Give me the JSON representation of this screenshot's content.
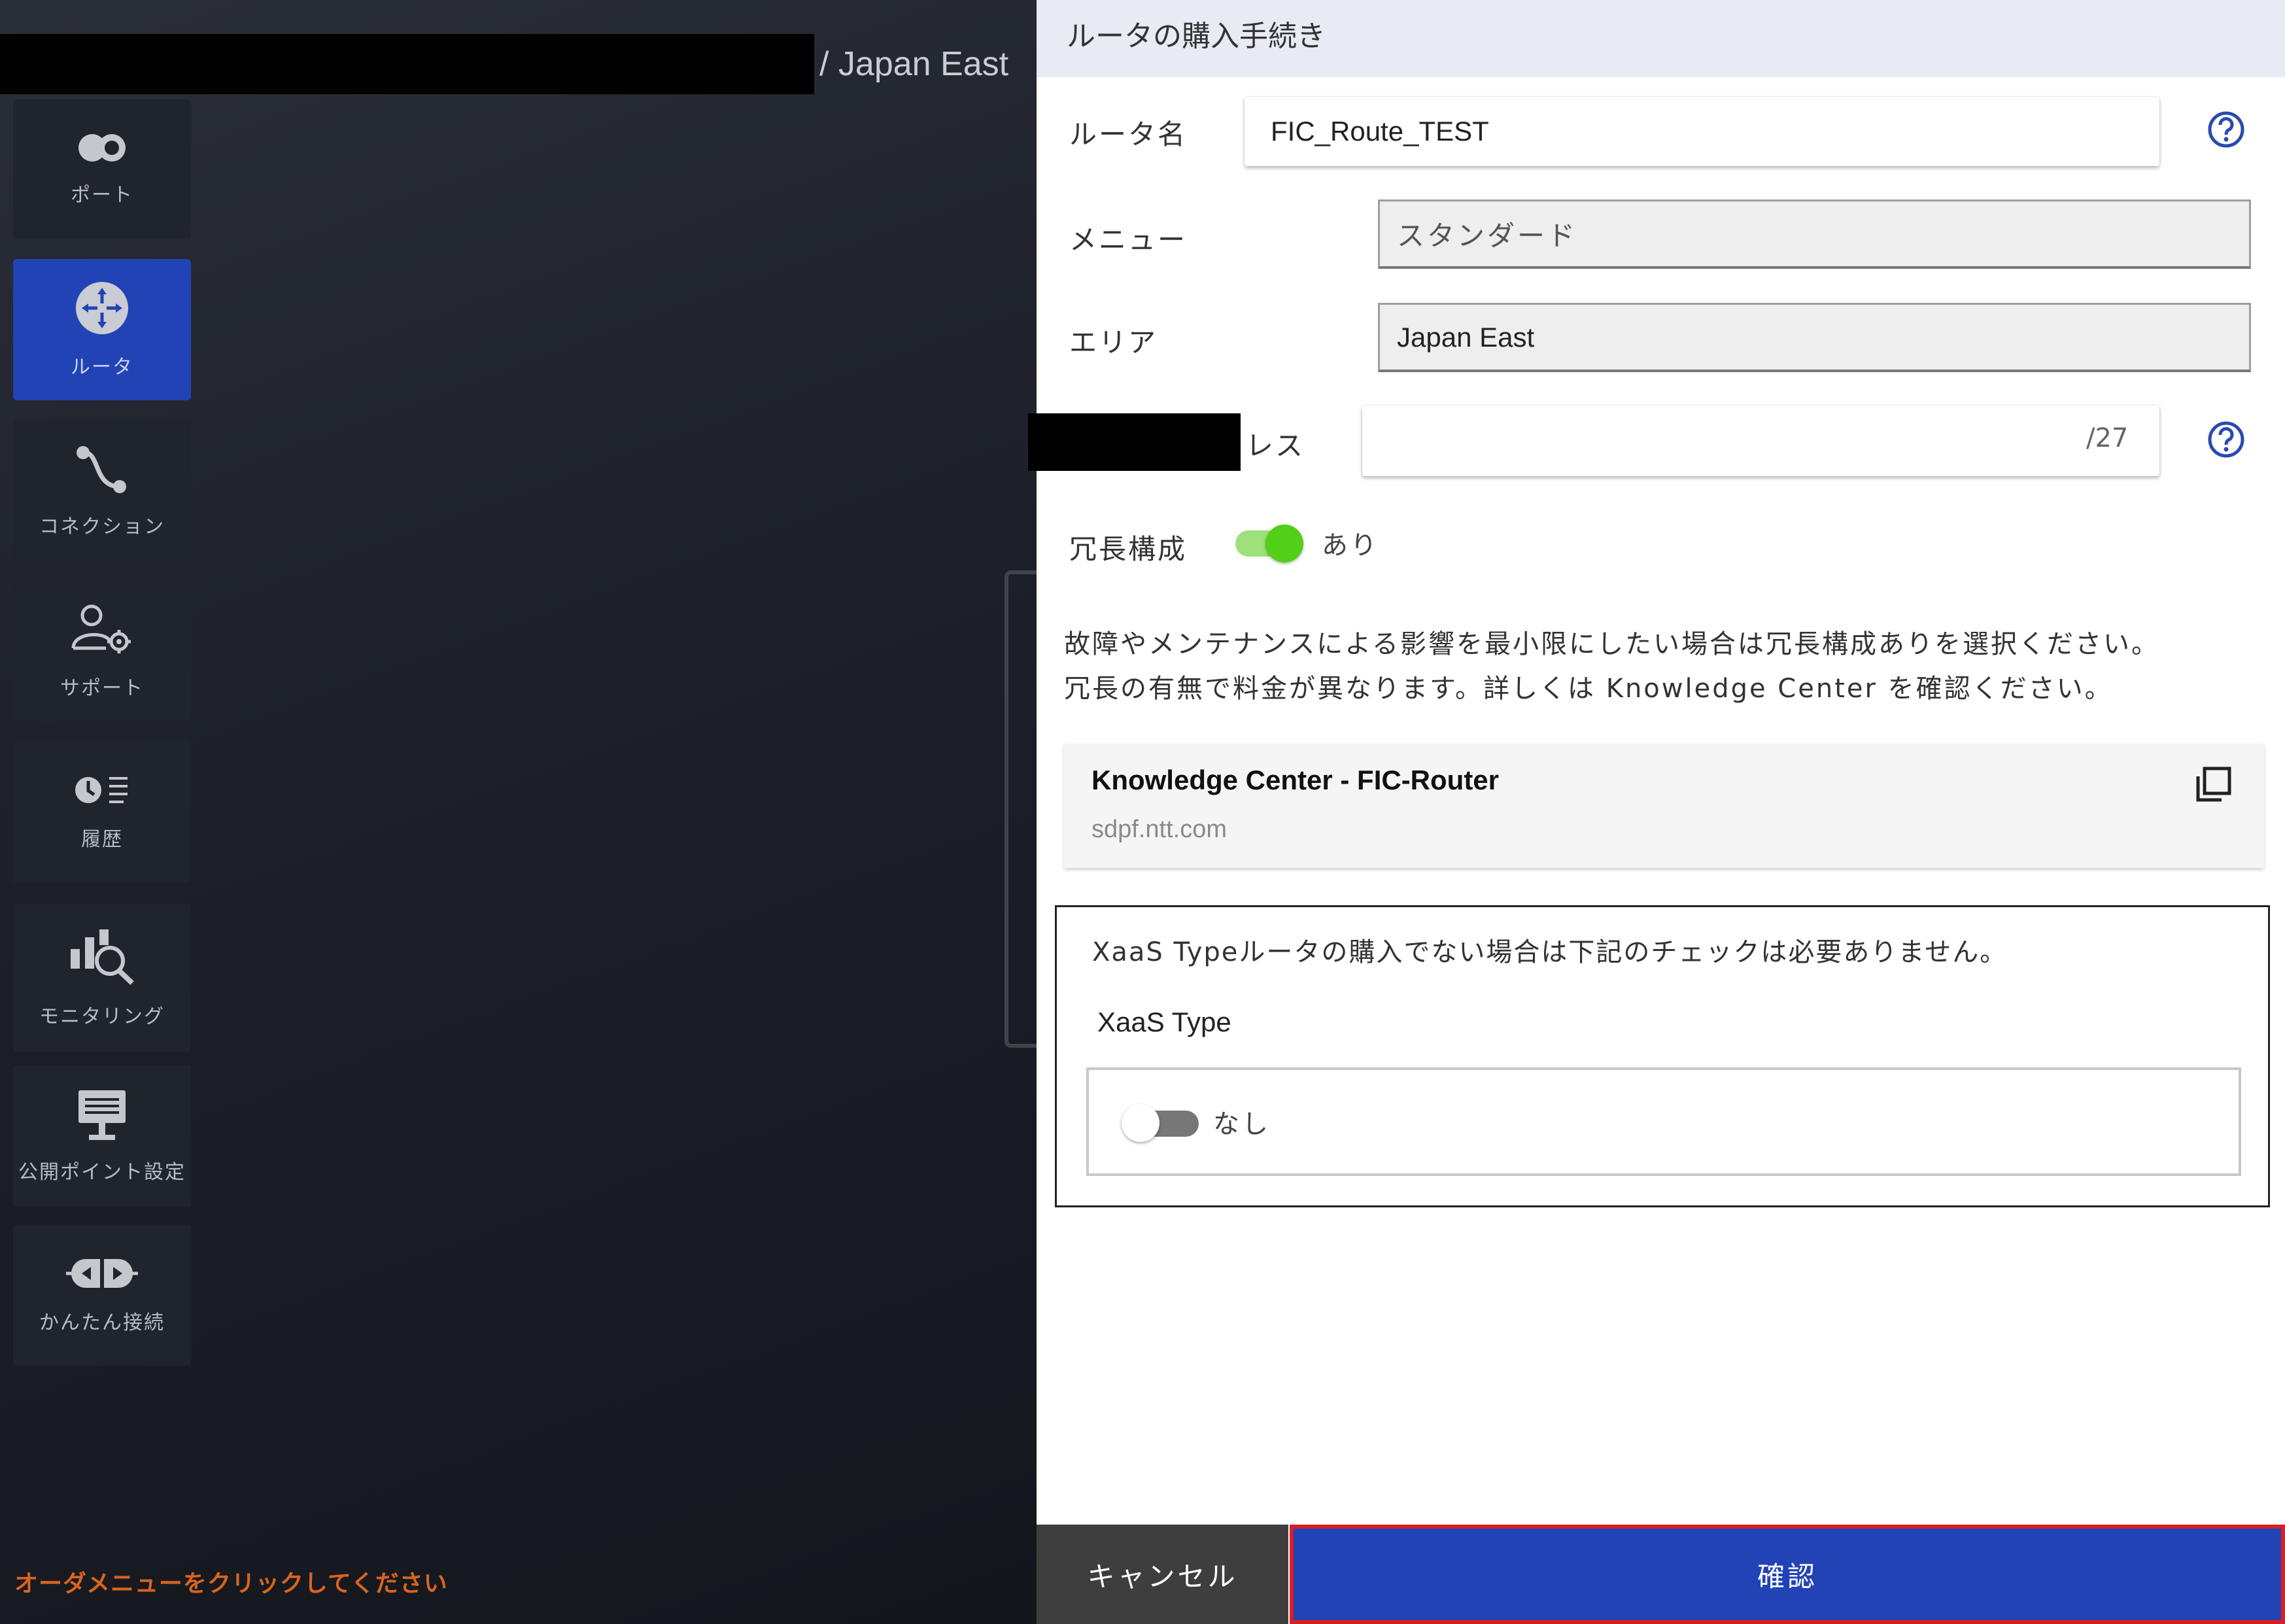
{
  "header": {
    "region": "/ Japan East"
  },
  "sidebar": {
    "items": [
      {
        "label": "ポート",
        "icon": "port-icon"
      },
      {
        "label": "ルータ",
        "icon": "router-icon",
        "active": true
      },
      {
        "label": "コネクション",
        "icon": "connection-icon"
      },
      {
        "label": "サポート",
        "icon": "support-icon"
      },
      {
        "label": "履歴",
        "icon": "history-icon"
      },
      {
        "label": "モニタリング",
        "icon": "monitoring-icon"
      },
      {
        "label": "公開ポイント設定",
        "icon": "public-point-icon"
      },
      {
        "label": "かんたん接続",
        "icon": "easy-connect-icon"
      }
    ],
    "order_hint": "オーダメニューをクリックしてください"
  },
  "drawer": {
    "title": "ルータの購入手続き",
    "router_name": {
      "label": "ルータ名",
      "value": "FIC_Route_TEST"
    },
    "menu": {
      "label": "メニュー",
      "value": "スタンダード"
    },
    "area": {
      "label": "エリア",
      "value": "Japan East"
    },
    "address": {
      "label": "網内利用アドレス",
      "suffix": "/27"
    },
    "redundancy": {
      "label": "冗長構成",
      "toggle_text": "あり",
      "enabled": true
    },
    "info_line1": "故障やメンテナンスによる影響を最小限にしたい場合は冗長構成ありを選択ください。",
    "info_line2": "冗長の有無で料金が異なります。詳しくは Knowledge Center を確認ください。",
    "kc_card": {
      "title": "Knowledge Center - FIC-Router",
      "domain": "sdpf.ntt.com"
    },
    "xaas": {
      "note": "XaaS Typeルータの購入でない場合は下記のチェックは必要ありません。",
      "label": "XaaS Type",
      "toggle_text": "なし",
      "enabled": false
    },
    "cancel_label": "キャンセル",
    "confirm_label": "確認"
  },
  "colors": {
    "accent": "#2243b6",
    "highlight": "#d91f26",
    "toggle_on": "#52d017",
    "hint": "#d9641f",
    "help_icon": "#2a4ab0"
  }
}
